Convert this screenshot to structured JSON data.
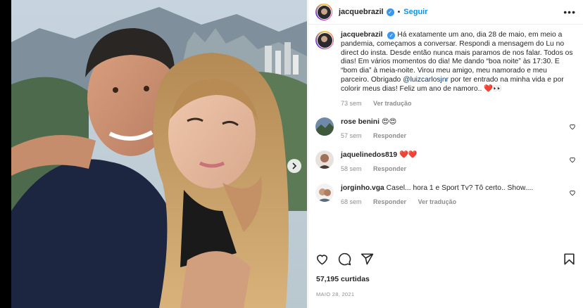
{
  "post": {
    "author": "jacquebrazil",
    "follow_label": "Seguir",
    "separator": "•",
    "more_label": "•••",
    "verified_mark": "✓",
    "caption": {
      "text_before_mention": "Há exatamente um ano, dia 28 de maio, em meio a pandemia, começamos a conversar. Respondi a mensagem do Lu no direct do insta. Desde então nunca mais paramos de nos falar. Todos os dias! Em vários momentos do dia! Me dando “boa noite” às 17:30. E “bom dia” à meia-noite. Virou meu amigo, meu namorado e meu parceiro. Obrigado ",
      "mention": "@luizcarlosjnr",
      "text_after_mention": " por ter entrado na minha vida e por colorir meus dias! Feliz um ano de namoro.. ❤️👀",
      "time": "73 sem",
      "translate": "Ver tradução"
    },
    "likes": "57,195 curtidas",
    "date": "MAIO 28, 2021"
  },
  "comments": [
    {
      "user": "rose benini",
      "text": "😍😍",
      "time": "57 sem",
      "reply": "Responder"
    },
    {
      "user": "jaquelinedos819",
      "text": "❤️❤️",
      "time": "58 sem",
      "reply": "Responder"
    },
    {
      "user": "jorginho.vga",
      "text": "Casel... hora 1 e Sport Tv? Tô certo.. Show....",
      "time": "68 sem",
      "reply": "Responder",
      "translate": "Ver tradução"
    }
  ],
  "icons": {
    "like": "heart-icon",
    "comment": "comment-icon",
    "share": "share-icon",
    "save": "bookmark-icon",
    "carousel_next": "chevron-right-icon"
  },
  "colors": {
    "follow": "#0095f6",
    "verified": "#3897f0",
    "muted": "#8e8e8e",
    "mention": "#00376b"
  }
}
